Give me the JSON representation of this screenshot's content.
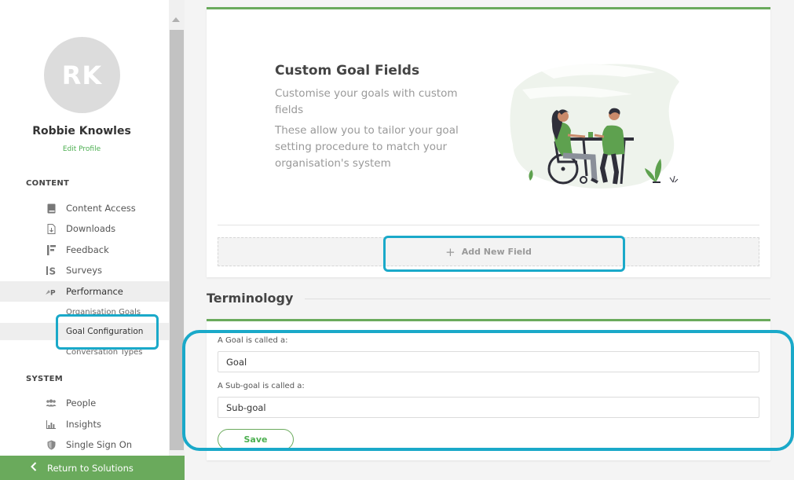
{
  "sidebar": {
    "avatar_initials": "RK",
    "user_name": "Robbie Knowles",
    "edit_profile": "Edit Profile",
    "content_section": "CONTENT",
    "content_items": [
      {
        "label": "Content Access",
        "icon": "book-icon"
      },
      {
        "label": "Downloads",
        "icon": "download-file-icon"
      },
      {
        "label": "Feedback",
        "icon": "feedback-icon"
      },
      {
        "label": "Surveys",
        "icon": "surveys-icon"
      },
      {
        "label": "Performance",
        "icon": "performance-icon"
      }
    ],
    "performance_subitems": [
      {
        "label": "Organisation Goals"
      },
      {
        "label": "Goal Configuration"
      },
      {
        "label": "Conversation Types"
      }
    ],
    "system_section": "SYSTEM",
    "system_items": [
      {
        "label": "People",
        "icon": "people-icon"
      },
      {
        "label": "Insights",
        "icon": "insights-icon"
      },
      {
        "label": "Single Sign On",
        "icon": "shield-icon"
      }
    ],
    "return_label": "Return to Solutions"
  },
  "custom_goal_fields": {
    "title": "Custom Goal Fields",
    "description_1": "Customise your goals with custom fields",
    "description_2": "These allow you to tailor your goal setting procedure to match your organisation's system",
    "add_field_label": "Add New Field"
  },
  "terminology": {
    "heading": "Terminology",
    "goal_label": "A Goal is called a:",
    "goal_value": "Goal",
    "subgoal_label": "A Sub-goal is called a:",
    "subgoal_value": "Sub-goal",
    "save_label": "Save"
  },
  "colors": {
    "accent_green": "#6aaa5c",
    "highlight_blue": "#1aa9c9",
    "avatar_gray": "#dcdcdc"
  }
}
